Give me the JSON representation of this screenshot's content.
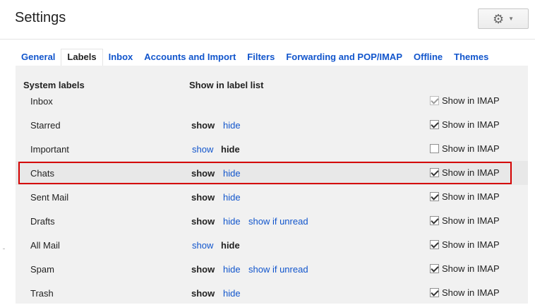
{
  "header": {
    "title": "Settings",
    "gear_icon": "gear-icon",
    "chevron_icon": "chevron-down-icon"
  },
  "tabs": [
    {
      "label": "General",
      "active": false
    },
    {
      "label": "Labels",
      "active": true
    },
    {
      "label": "Inbox",
      "active": false
    },
    {
      "label": "Accounts and Import",
      "active": false
    },
    {
      "label": "Filters",
      "active": false
    },
    {
      "label": "Forwarding and POP/IMAP",
      "active": false
    },
    {
      "label": "Offline",
      "active": false
    },
    {
      "label": "Themes",
      "active": false
    }
  ],
  "columns": {
    "system_labels": "System labels",
    "show_in_label_list": "Show in label list"
  },
  "labels": [
    {
      "name": "Inbox",
      "show": "",
      "hide": "",
      "show_if_unread": "",
      "state": "none",
      "imap_label": "Show in IMAP",
      "imap_checked": true,
      "imap_disabled": true
    },
    {
      "name": "Starred",
      "show": "show",
      "hide": "hide",
      "show_if_unread": "",
      "state": "show",
      "imap_label": "Show in IMAP",
      "imap_checked": true,
      "imap_disabled": false
    },
    {
      "name": "Important",
      "show": "show",
      "hide": "hide",
      "show_if_unread": "",
      "state": "hide",
      "imap_label": "Show in IMAP",
      "imap_checked": false,
      "imap_disabled": false
    },
    {
      "name": "Chats",
      "show": "show",
      "hide": "hide",
      "show_if_unread": "",
      "state": "show",
      "imap_label": "Show in IMAP",
      "imap_checked": true,
      "imap_disabled": false,
      "highlighted": true
    },
    {
      "name": "Sent Mail",
      "show": "show",
      "hide": "hide",
      "show_if_unread": "",
      "state": "show",
      "imap_label": "Show in IMAP",
      "imap_checked": true,
      "imap_disabled": false
    },
    {
      "name": "Drafts",
      "show": "show",
      "hide": "hide",
      "show_if_unread": "show if unread",
      "state": "show",
      "imap_label": "Show in IMAP",
      "imap_checked": true,
      "imap_disabled": false
    },
    {
      "name": "All Mail",
      "show": "show",
      "hide": "hide",
      "show_if_unread": "",
      "state": "hide",
      "imap_label": "Show in IMAP",
      "imap_checked": true,
      "imap_disabled": false
    },
    {
      "name": "Spam",
      "show": "show",
      "hide": "hide",
      "show_if_unread": "show if unread",
      "state": "show",
      "imap_label": "Show in IMAP",
      "imap_checked": true,
      "imap_disabled": false
    },
    {
      "name": "Trash",
      "show": "show",
      "hide": "hide",
      "show_if_unread": "",
      "state": "show",
      "imap_label": "Show in IMAP",
      "imap_checked": true,
      "imap_disabled": false
    }
  ],
  "colors": {
    "link": "#1155cc",
    "highlight_border": "#d40000",
    "panel_bg": "#f1f1f1"
  }
}
